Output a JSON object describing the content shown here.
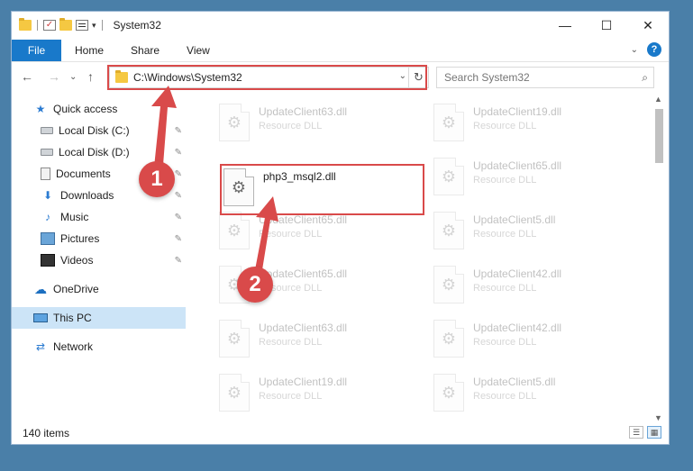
{
  "window": {
    "title": "System32"
  },
  "window_controls": {
    "minimize": "—",
    "maximize": "☐",
    "close": "✕"
  },
  "ribbon": {
    "tabs": [
      "File",
      "Home",
      "Share",
      "View"
    ],
    "expand_glyph": "⌄",
    "help_glyph": "?"
  },
  "nav": {
    "back": "←",
    "forward": "→",
    "recent": "⌄",
    "up": "↑"
  },
  "address": {
    "path": "C:\\Windows\\System32",
    "dropdown": "⌄",
    "refresh": "↻"
  },
  "search": {
    "placeholder": "Search System32",
    "icon": "⌕"
  },
  "sidebar": {
    "items": [
      {
        "label": "Quick access",
        "icon": "star-icon",
        "glyph": "★",
        "pinned": false
      },
      {
        "label": "Local Disk (C:)",
        "icon": "drive-icon",
        "glyph": "",
        "pinned": true
      },
      {
        "label": "Local Disk (D:)",
        "icon": "drive-icon",
        "glyph": "",
        "pinned": true
      },
      {
        "label": "Documents",
        "icon": "documents-icon",
        "glyph": "",
        "pinned": true
      },
      {
        "label": "Downloads",
        "icon": "download-icon",
        "glyph": "⬇",
        "pinned": true
      },
      {
        "label": "Music",
        "icon": "music-icon",
        "glyph": "♪",
        "pinned": true
      },
      {
        "label": "Pictures",
        "icon": "pictures-icon",
        "glyph": "",
        "pinned": true
      },
      {
        "label": "Videos",
        "icon": "videos-icon",
        "glyph": "",
        "pinned": true
      },
      {
        "label": "OneDrive",
        "icon": "cloud-icon",
        "glyph": "☁",
        "pinned": false
      },
      {
        "label": "This PC",
        "icon": "computer-icon",
        "glyph": "",
        "pinned": false
      },
      {
        "label": "Network",
        "icon": "network-icon",
        "glyph": "⇄",
        "pinned": false
      }
    ],
    "pin_glyph": "📌"
  },
  "files": [
    {
      "name": "UpdateClient63.dll",
      "type": "Resource DLL",
      "faded": true
    },
    {
      "name": "UpdateClient19.dll",
      "type": "Resource DLL",
      "faded": true
    },
    {
      "name": "php3_msql2.dll",
      "type": "",
      "faded": false
    },
    {
      "name": "UpdateClient65.dll",
      "type": "Resource DLL",
      "faded": true
    },
    {
      "name": "UpdateClient65.dll",
      "type": "Resource DLL",
      "faded": true
    },
    {
      "name": "UpdateClient5.dll",
      "type": "Resource DLL",
      "faded": true
    },
    {
      "name": "UpdateClient65.dll",
      "type": "Resource DLL",
      "faded": true
    },
    {
      "name": "UpdateClient42.dll",
      "type": "Resource DLL",
      "faded": true
    },
    {
      "name": "UpdateClient63.dll",
      "type": "Resource DLL",
      "faded": true
    },
    {
      "name": "UpdateClient42.dll",
      "type": "Resource DLL",
      "faded": true
    },
    {
      "name": "UpdateClient19.dll",
      "type": "Resource DLL",
      "faded": true
    },
    {
      "name": "UpdateClient5.dll",
      "type": "Resource DLL",
      "faded": true
    }
  ],
  "file_icon_glyph": "⚙",
  "status": {
    "item_count": "140 items"
  },
  "annotations": {
    "step1": "1",
    "step2": "2",
    "color": "#d94a4a"
  },
  "colors": {
    "accent": "#1979ca",
    "selection": "#cce4f7",
    "highlight": "#d94a4a"
  }
}
